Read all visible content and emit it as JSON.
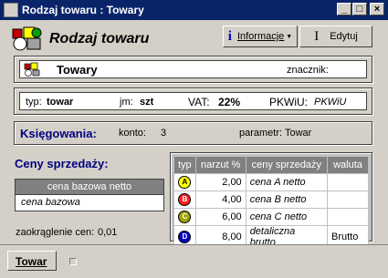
{
  "window": {
    "title": "Rodzaj towaru : Towary"
  },
  "header": {
    "title": "Rodzaj towaru",
    "info_label": "Informacje",
    "edit_label": "Edytuj"
  },
  "record": {
    "name": "Towary",
    "marker_label": "znacznik:"
  },
  "details": {
    "typ_label": "typ:",
    "typ_value": "towar",
    "jm_label": "jm:",
    "jm_value": "szt",
    "vat_label": "VAT:",
    "vat_value": "22%",
    "pkwiu_label": "PKWiU:",
    "pkwiu_value": "PKWiU"
  },
  "accounting": {
    "title": "Księgowania:",
    "konto_label": "konto:",
    "konto_value": "3",
    "param_label": "parametr:",
    "param_value": "Towar"
  },
  "prices": {
    "title": "Ceny sprzedaży:",
    "base_header": "cena bazowa netto",
    "base_value": "cena bazowa",
    "rounding_label": "zaokrąglenie cen:",
    "rounding_value": "0,01",
    "columns": [
      "typ",
      "narzut %",
      "ceny sprzedaży",
      "waluta"
    ],
    "rows": [
      {
        "typ": "A",
        "color": "#ffff00",
        "narzut": "2,00",
        "cena": "cena A netto",
        "waluta": ""
      },
      {
        "typ": "B",
        "color": "#ff2020",
        "narzut": "4,00",
        "cena": "cena B netto",
        "waluta": ""
      },
      {
        "typ": "C",
        "color": "#a0a000",
        "narzut": "6,00",
        "cena": "cena C netto",
        "waluta": ""
      },
      {
        "typ": "D",
        "color": "#0000c0",
        "narzut": "8,00",
        "cena": "detaliczna brutto",
        "waluta": "Brutto"
      }
    ]
  },
  "tabs": [
    {
      "label": "Towar"
    }
  ],
  "icons": [
    "app-icon",
    "goods-icon",
    "info-icon",
    "edit-cursor-icon",
    "minimize-icon",
    "maximize-icon",
    "close-icon"
  ]
}
